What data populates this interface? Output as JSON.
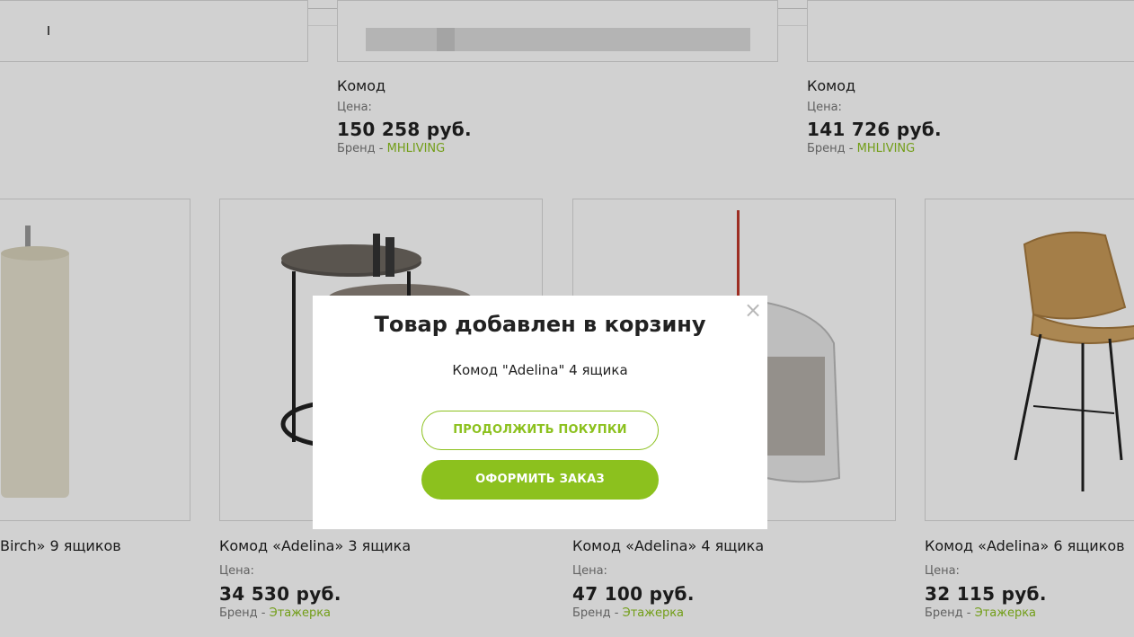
{
  "colors": {
    "accent": "#8cc11e",
    "overlay": "rgba(0,0,0,0.18)"
  },
  "top_cards": [
    {
      "title": "Комод",
      "price_label": "Цена:",
      "price": "150 258 руб.",
      "brand_prefix": "Бренд - ",
      "brand": "MHLIVING"
    },
    {
      "title": "Комод",
      "price_label": "Цена:",
      "price": "141 726 руб.",
      "brand_prefix": "Бренд - ",
      "brand": "MHLIVING"
    }
  ],
  "cards": [
    {
      "title": "Birch» 9 ящиков"
    },
    {
      "title": "Комод «Adelina» 3 ящика",
      "price_label": "Цена:",
      "price": "34 530 руб.",
      "brand_prefix": "Бренд - ",
      "brand": "Этажерка"
    },
    {
      "title": "Комод «Adelina» 4 ящика",
      "price_label": "Цена:",
      "price": "47 100 руб.",
      "brand_prefix": "Бренд - ",
      "brand": "Этажерка"
    },
    {
      "title": "Комод «Adelina» 6 ящиков",
      "price_label": "Цена:",
      "price": "32 115 руб.",
      "brand_prefix": "Бренд - ",
      "brand": "Этажерка"
    }
  ],
  "modal": {
    "title": "Товар добавлен в корзину",
    "product": "Комод \"Adelina\" 4 ящика",
    "continue_label": "ПРОДОЛЖИТЬ ПОКУПКИ",
    "checkout_label": "ОФОРМИТЬ ЗАКАЗ",
    "close_icon": "close-icon"
  }
}
